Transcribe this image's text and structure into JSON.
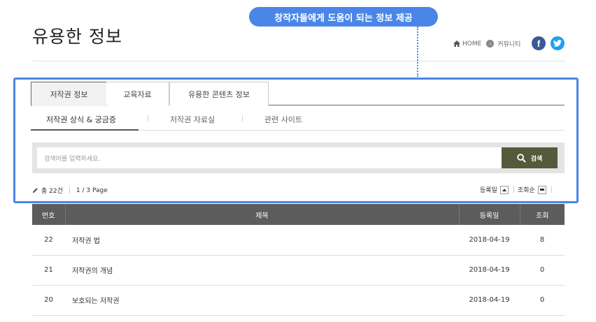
{
  "callout": {
    "text": "창작자들에게 도움이 되는 정보 제공"
  },
  "page": {
    "title": "유용한 정보"
  },
  "breadcrumb": {
    "home": "HOME",
    "current": "커뮤니티"
  },
  "social": {
    "facebook": "f",
    "twitter": "t"
  },
  "tabs": [
    {
      "label": "저작권 정보",
      "active": true
    },
    {
      "label": "교육자료",
      "active": false
    },
    {
      "label": "유용한 콘텐츠 정보",
      "active": false
    }
  ],
  "subtabs": [
    {
      "label": "저작권 상식 & 궁금증",
      "active": true
    },
    {
      "label": "저작권 자료실",
      "active": false
    },
    {
      "label": "관련 사이트",
      "active": false
    }
  ],
  "search": {
    "placeholder": "검색어를 입력하세요.",
    "button_label": "검색"
  },
  "info": {
    "total": "총 22건",
    "page": "1 / 3 Page",
    "sort_date": "등록일",
    "sort_views": "조회순"
  },
  "table": {
    "headers": [
      "번호",
      "제목",
      "등록일",
      "조회"
    ],
    "rows": [
      {
        "num": "22",
        "title": "저작권 법",
        "date": "2018-04-19",
        "views": "8"
      },
      {
        "num": "21",
        "title": "저작권의 개념",
        "date": "2018-04-19",
        "views": "0"
      },
      {
        "num": "20",
        "title": "보호되는 저작권",
        "date": "2018-04-19",
        "views": "0"
      }
    ]
  },
  "colors": {
    "accent": "#4a86e8",
    "header_bg": "#5c5c5c",
    "button_bg": "#555a3a"
  }
}
